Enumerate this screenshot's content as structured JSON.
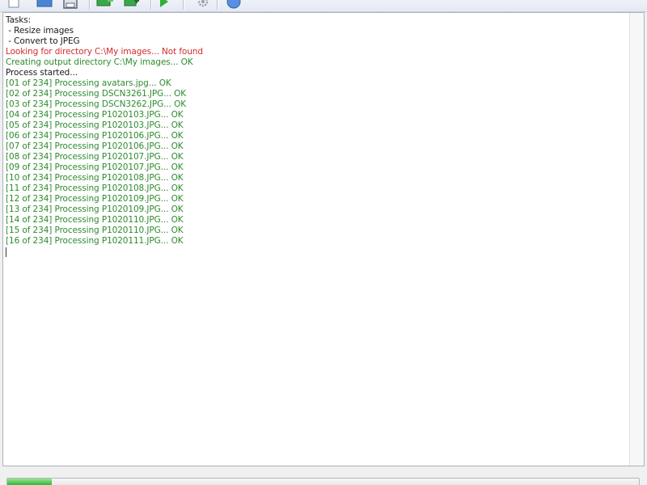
{
  "toolbar": {
    "buttons": [
      {
        "name": "new-file-icon"
      },
      {
        "name": "open-file-icon"
      },
      {
        "name": "save-icon"
      },
      {
        "name": "add-images-icon"
      },
      {
        "name": "add-folder-icon"
      },
      {
        "name": "run-icon"
      },
      {
        "name": "settings-icon"
      },
      {
        "name": "help-icon"
      }
    ]
  },
  "colors": {
    "normal": "#1a1a1a",
    "error": "#d22b2b",
    "ok": "#2e8b2e",
    "progress": "#3fc13f"
  },
  "log": {
    "lines": [
      {
        "text": "Tasks:",
        "type": "normal"
      },
      {
        "text": " - Resize images",
        "type": "normal"
      },
      {
        "text": " - Convert to JPEG",
        "type": "normal"
      },
      {
        "text": "Looking for directory C:\\My images... Not found",
        "type": "error"
      },
      {
        "text": "Creating output directory C:\\My images... OK",
        "type": "ok"
      },
      {
        "text": "Process started...",
        "type": "normal"
      },
      {
        "text": "[01 of 234] Processing avatars.jpg... OK",
        "type": "ok"
      },
      {
        "text": "[02 of 234] Processing DSCN3261.JPG... OK",
        "type": "ok"
      },
      {
        "text": "[03 of 234] Processing DSCN3262.JPG... OK",
        "type": "ok"
      },
      {
        "text": "[04 of 234] Processing P1020103.JPG... OK",
        "type": "ok"
      },
      {
        "text": "[05 of 234] Processing P1020103.JPG... OK",
        "type": "ok"
      },
      {
        "text": "[06 of 234] Processing P1020106.JPG... OK",
        "type": "ok"
      },
      {
        "text": "[07 of 234] Processing P1020106.JPG... OK",
        "type": "ok"
      },
      {
        "text": "[08 of 234] Processing P1020107.JPG... OK",
        "type": "ok"
      },
      {
        "text": "[09 of 234] Processing P1020107.JPG... OK",
        "type": "ok"
      },
      {
        "text": "[10 of 234] Processing P1020108.JPG... OK",
        "type": "ok"
      },
      {
        "text": "[11 of 234] Processing P1020108.JPG... OK",
        "type": "ok"
      },
      {
        "text": "[12 of 234] Processing P1020109.JPG... OK",
        "type": "ok"
      },
      {
        "text": "[13 of 234] Processing P1020109.JPG... OK",
        "type": "ok"
      },
      {
        "text": "[14 of 234] Processing P1020110.JPG... OK",
        "type": "ok"
      },
      {
        "text": "[15 of 234] Processing P1020110.JPG... OK",
        "type": "ok"
      },
      {
        "text": "[16 of 234] Processing P1020111.JPG... OK",
        "type": "ok"
      }
    ]
  },
  "progress": {
    "value": 0.07
  }
}
